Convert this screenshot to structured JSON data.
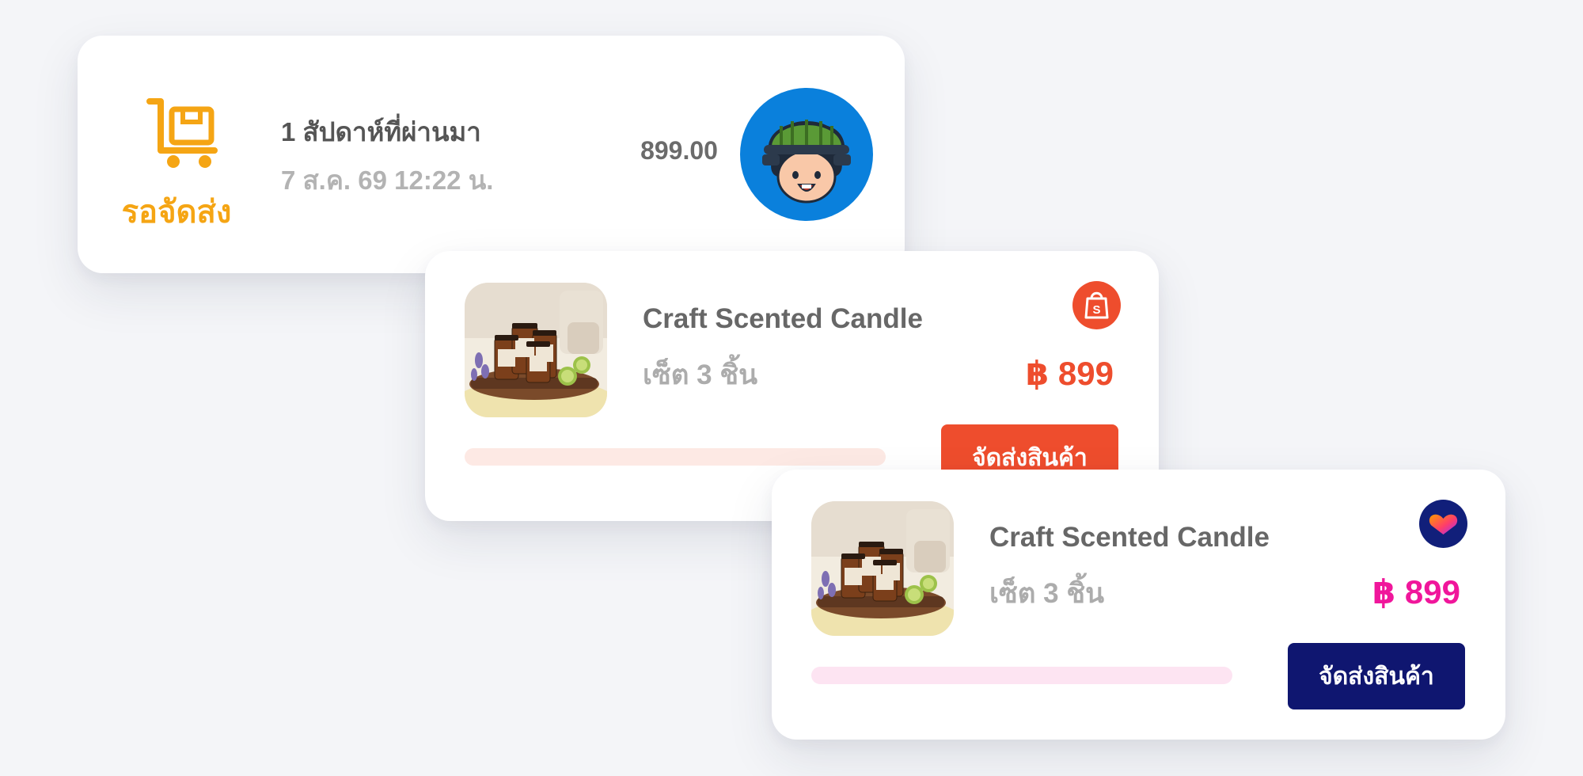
{
  "colors": {
    "background": "#f4f5f8",
    "status_accent": "#f5a514",
    "shopee_accent": "#ee4d2d",
    "lazada_price": "#f0169b",
    "lazada_button": "#0f1670"
  },
  "order": {
    "status_icon": "delivery-cart-icon",
    "status_label": "รอจัดส่ง",
    "period": "1 สัปดาห์ที่ผ่านมา",
    "datetime": "7 ส.ค. 69 12:22 น.",
    "amount": "899.00",
    "avatar_icon": "cartoon-avatar-icon"
  },
  "products": [
    {
      "platform": "shopee",
      "platform_icon": "shopee-bag-icon",
      "title": "Craft Scented Candle",
      "variant": "เซ็ต 3 ชิ้น",
      "price": "฿ 899",
      "ship_label": "จัดส่งสินค้า",
      "progress": 0
    },
    {
      "platform": "lazada",
      "platform_icon": "lazada-heart-icon",
      "title": "Craft Scented Candle",
      "variant": "เซ็ต 3 ชิ้น",
      "price": "฿ 899",
      "ship_label": "จัดส่งสินค้า",
      "progress": 0
    }
  ]
}
